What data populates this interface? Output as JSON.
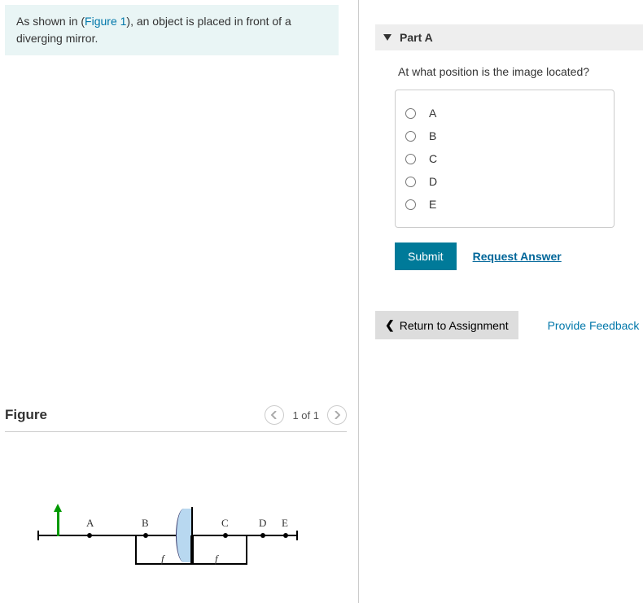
{
  "prompt": {
    "pre": "As shown in (",
    "link": "Figure 1",
    "post": "), an object is placed in front of a diverging mirror."
  },
  "part": {
    "label": "Part A",
    "question": "At what position is the image located?",
    "options": [
      "A",
      "B",
      "C",
      "D",
      "E"
    ]
  },
  "actions": {
    "submit": "Submit",
    "request": "Request Answer",
    "return": "Return to Assignment",
    "feedback": "Provide Feedback"
  },
  "figure": {
    "title": "Figure",
    "pager": "1 of 1",
    "points": [
      "A",
      "B",
      "C",
      "D",
      "E"
    ],
    "f_label": "f"
  }
}
